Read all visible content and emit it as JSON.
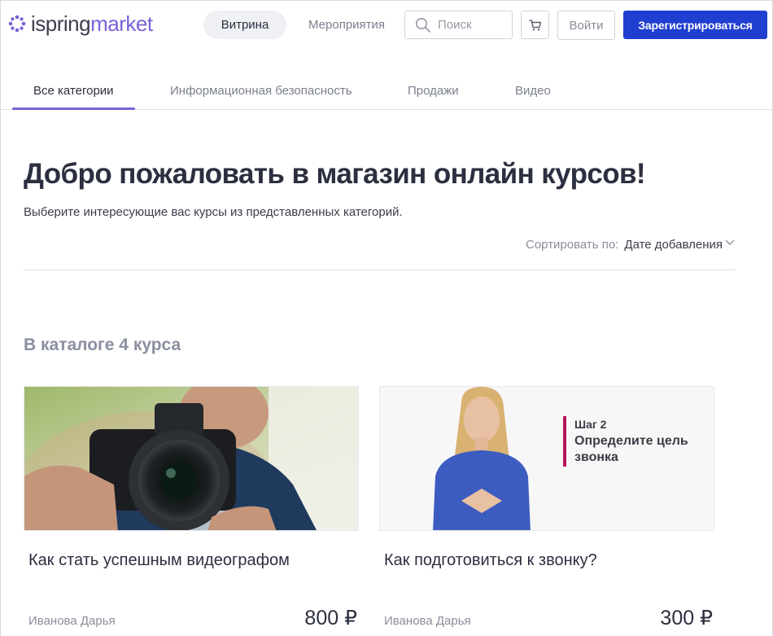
{
  "brand": {
    "name_part1": "ispring",
    "name_part2": "market",
    "accent_color": "#7b61d9",
    "primary_color": "#1f3fd1"
  },
  "header": {
    "nav": [
      {
        "label": "Витрина",
        "active": true
      },
      {
        "label": "Мероприятия",
        "active": false
      }
    ],
    "search": {
      "placeholder": "Поиск",
      "value": ""
    },
    "cart_icon": "cart-icon",
    "login_label": "Войти",
    "register_label": "Зарегистрироваться"
  },
  "categories": [
    {
      "label": "Все категории",
      "active": true
    },
    {
      "label": "Информационная безопасность",
      "active": false
    },
    {
      "label": "Продажи",
      "active": false
    },
    {
      "label": "Видео",
      "active": false
    }
  ],
  "main": {
    "title": "Добро пожаловать в магазин онлайн курсов!",
    "subtitle": "Выберите интересующие вас курсы из представленных категорий.",
    "sort_label": "Сортировать по:",
    "sort_value": "Дате добавления",
    "catalog_count": "В каталоге 4 курса"
  },
  "courses": [
    {
      "title": "Как стать успешным видеографом",
      "author": "Иванова Дарья",
      "price": "800 ₽",
      "image": "photographer-with-camera"
    },
    {
      "title": "Как подготовиться к звонку?",
      "author": "Иванова Дарья",
      "price": "300 ₽",
      "image": "presenter-slide",
      "slide_step": "Шаг 2",
      "slide_heading": "Определите цель звонка"
    }
  ]
}
